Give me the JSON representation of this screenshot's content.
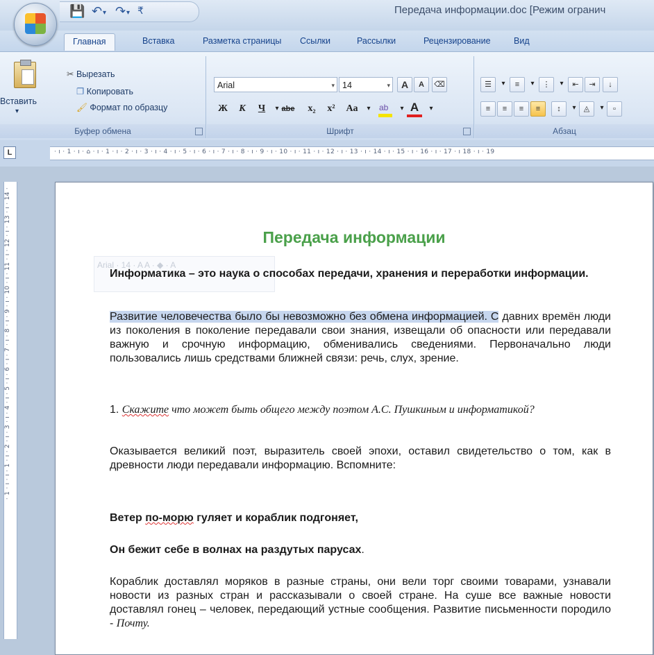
{
  "window": {
    "title": "Передача информации.doc [Режим огранич"
  },
  "quick_access": {
    "save_icon": "save-icon",
    "undo_icon": "undo-icon",
    "redo_icon": "redo-icon"
  },
  "tabs": [
    {
      "label": "Главная"
    },
    {
      "label": "Вставка"
    },
    {
      "label": "Разметка страницы"
    },
    {
      "label": "Ссылки"
    },
    {
      "label": "Рассылки"
    },
    {
      "label": "Рецензирование"
    },
    {
      "label": "Вид"
    }
  ],
  "ribbon": {
    "clipboard": {
      "paste": "Вставить",
      "cut": "Вырезать",
      "copy": "Копировать",
      "format_painter": "Формат по образцу",
      "label": "Буфер обмена"
    },
    "font": {
      "font_name": "Arial",
      "font_size": "14",
      "bold": "Ж",
      "italic": "К",
      "underline": "Ч",
      "strike": "abe",
      "subscript": "x₂",
      "superscript": "x²",
      "change_case": "Aa",
      "grow": "A",
      "shrink": "A",
      "label": "Шрифт"
    },
    "paragraph": {
      "label": "Абзац"
    }
  },
  "ruler": {
    "horizontal": "· ı · 1 · ı · ⌂ · ı · 1 · ı · 2 · ı · 3 · ı · 4 · ı · 5 · ı · 6 · ı · 7 · ı · 8 · ı · 9 · ı · 10 · ı · 11 · ı · 12 · ı · 13 · ı · 14 · ı · 15 · ı · 16 · ı · 17 · ı 18 · ı · 19",
    "vertical": "· 1 · ı · ı · 1 · ı · 2 · ı · 3 · ı · 4 · ı · 5 · ı · 6 · ı · 7 · ı · 8 · ı · 9 · ı · 10 · ı · 11 · ı · 12 · ı · 13 · ı · 14 ·"
  },
  "document": {
    "title": "Передача информации",
    "intro": "Информатика – это наука о способах передачи, хранения и переработки информации.",
    "p1_highlight": "Развитие человечества было бы невозможно без обмена информацией. С",
    "p1_rest": " давних времён люди из поколения в поколение передавали свои знания, извещали об опасности или передавали важную и срочную информацию, обменивались сведениями. Первоначально люди пользовались лишь средствами ближней связи: речь, слух, зрение.",
    "q1_num": "1. ",
    "q1_word": "Скажите",
    "q1_rest": " что может быть общего между поэтом А.С. Пушкиным и информатикой?",
    "p2": "Оказывается великий поэт, выразитель своей эпохи, оставил свидетельство о том, как в древности люди передавали информацию. Вспомните:",
    "verse1_a": "Ветер ",
    "verse1_b": "по-морю",
    "verse1_c": " гуляет и кораблик подгоняет,",
    "verse2": "Он бежит себе в волнах на раздутых парусах",
    "verse2_end": ".",
    "p3": "Кораблик доставлял моряков в разные страны, они вели торг своими товарами, узнавали новости из разных стран и рассказывали о своей стране. На суше все важные новости доставлял гонец – человек, передающий устные сообщения. Развитие письменности породило - ",
    "p3_end": "Почту."
  }
}
